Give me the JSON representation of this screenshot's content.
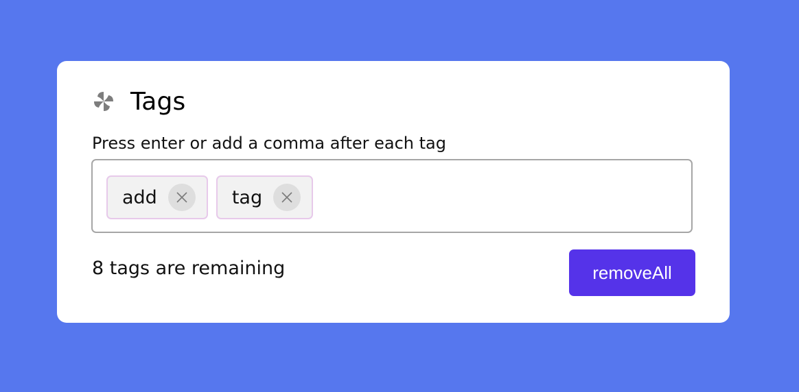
{
  "header": {
    "icon": "pinwheel-icon",
    "title": "Tags"
  },
  "hint": "Press enter or add a comma after each tag",
  "tags": [
    {
      "label": "add",
      "remove_icon": "close-icon"
    },
    {
      "label": "tag",
      "remove_icon": "close-icon"
    }
  ],
  "remaining_text": "8 tags are remaining",
  "remove_all_label": "removeAll",
  "colors": {
    "background": "#5677ee",
    "card": "#ffffff",
    "button": "#5533e9",
    "tag_border": "#e7c9ea",
    "tag_fill": "#f2f2f2"
  }
}
